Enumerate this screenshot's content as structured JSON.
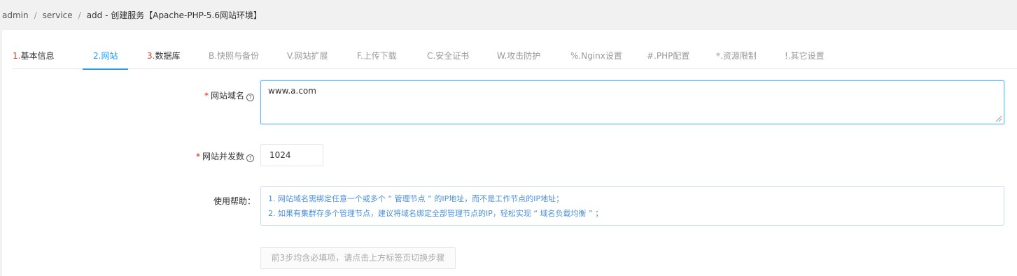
{
  "breadcrumb": {
    "items": [
      "admin",
      "service"
    ],
    "current": "add - 创建服务【Apache-PHP-5.6网站环境】"
  },
  "tabs": [
    {
      "num": "1.",
      "text": "基本信息"
    },
    {
      "num": "",
      "text": "2.网站"
    },
    {
      "num": "3.",
      "text": "数据库"
    },
    {
      "num": "",
      "text": "B.快照与备份"
    },
    {
      "num": "",
      "text": "V.网站扩展"
    },
    {
      "num": "",
      "text": "F.上传下载"
    },
    {
      "num": "",
      "text": "C.安全证书"
    },
    {
      "num": "",
      "text": "W.攻击防护"
    },
    {
      "num": "",
      "text": "%.Nginx设置"
    },
    {
      "num": "",
      "text": "#.PHP配置"
    },
    {
      "num": "",
      "text": "*.资源限制"
    },
    {
      "num": "",
      "text": "!.其它设置"
    }
  ],
  "form": {
    "domain_label": "网站域名",
    "domain_value": "www.a.com",
    "concurrency_label": "网站并发数",
    "concurrency_value": "1024",
    "help_label": "使用帮助：",
    "help_lines": [
      "1. 网站域名需绑定任意一个或多个 “ 管理节点 ” 的IP地址，而不是工作节点的IP地址；",
      "2. 如果有集群存多个管理节点，建议将域名绑定全部管理节点的IP，轻松实现 “ 域名负载均衡 ” ；"
    ],
    "step_button": "前3步均含必填项，请点击上方标签页切换步骤",
    "required_mark": "*",
    "help_icon_glyph": "?"
  },
  "colors": {
    "accent": "#1e9fff",
    "required": "#e2231a",
    "tab_number": "#d9412b",
    "help_text": "#4a8fde"
  }
}
